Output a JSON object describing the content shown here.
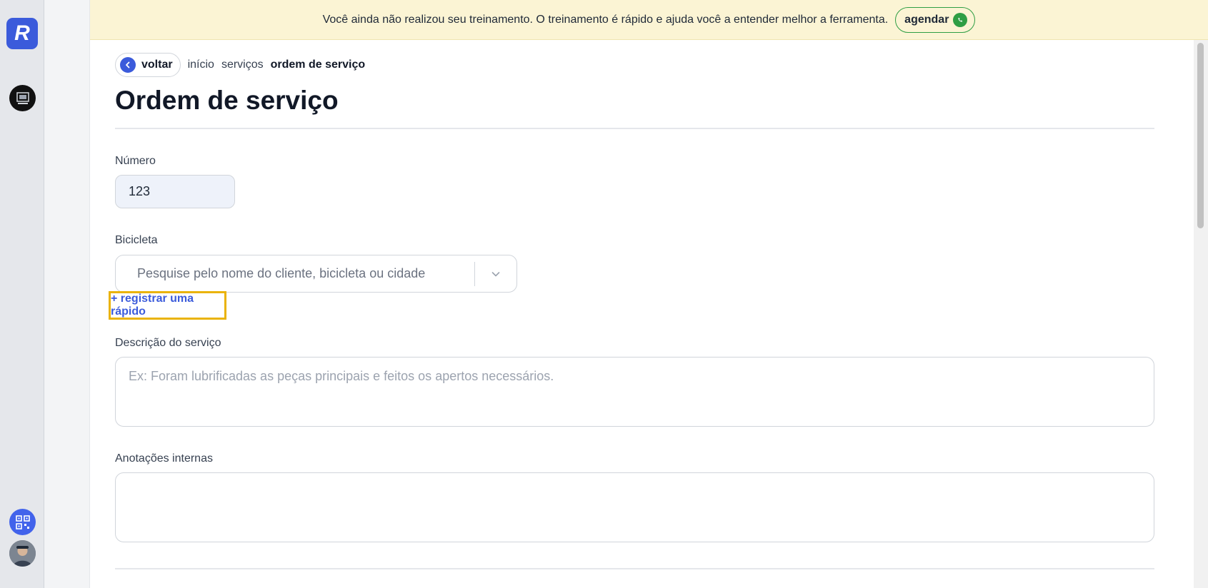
{
  "banner": {
    "message": "Você ainda não realizou seu treinamento. O treinamento é rápido e ajuda você a entender melhor a ferramenta.",
    "button_label": "agendar",
    "button_icon": "whatsapp-icon"
  },
  "sidebar": {
    "logo_letter": "R",
    "icons": [
      "shop-avatar",
      "qr-code-icon",
      "user-avatar"
    ]
  },
  "breadcrumb": {
    "back_label": "voltar",
    "items": [
      "início",
      "serviços",
      "ordem de serviço"
    ]
  },
  "page": {
    "title": "Ordem de serviço"
  },
  "form": {
    "numero": {
      "label": "Número",
      "value": "123"
    },
    "bicicleta": {
      "label": "Bicicleta",
      "placeholder": "Pesquise pelo nome do cliente, bicicleta ou cidade",
      "quick_register_label": "+ registrar uma rápido"
    },
    "descricao": {
      "label": "Descrição do serviço",
      "placeholder": "Ex: Foram lubrificadas as peças principais e feitos os apertos necessários."
    },
    "anotacoes": {
      "label": "Anotações internas",
      "placeholder": ""
    }
  },
  "colors": {
    "accent": "#3b5bdb",
    "banner_bg": "#fbf4d4",
    "whatsapp": "#2f9e44",
    "highlight": "#eab308"
  }
}
